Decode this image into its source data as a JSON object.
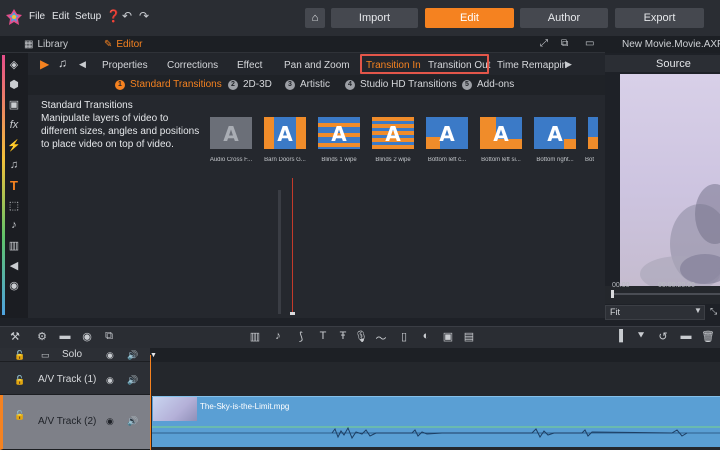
{
  "menu": {
    "file": "File",
    "edit": "Edit",
    "setup": "Setup"
  },
  "modes": {
    "import": "Import",
    "edit": "Edit",
    "author": "Author",
    "export": "Export",
    "active": "Edit"
  },
  "library_tabs": {
    "library": "Library",
    "editor": "Editor"
  },
  "project_title": "New Movie.Movie.AXP",
  "effect_tabs": [
    "Properties",
    "Corrections",
    "Effect",
    "Pan and Zoom",
    "Transition In",
    "Transition Out",
    "Time Remappin"
  ],
  "categories": [
    {
      "num": "1",
      "label": "Standard Transitions"
    },
    {
      "num": "2",
      "label": "2D-3D"
    },
    {
      "num": "3",
      "label": "Artistic"
    },
    {
      "num": "4",
      "label": "Studio HD Transitions"
    },
    {
      "num": "5",
      "label": "Add-ons"
    }
  ],
  "description": {
    "title": "Standard Transitions",
    "body": "Manipulate layers of video to different sizes, angles and positions to place video on top of video."
  },
  "transitions": [
    "Audio Cross F...",
    "Barn Doors G...",
    "Blinds 1 wipe",
    "Blinds 2 wipe",
    "Bottom left c...",
    "Bottom left si...",
    "Bottom right...",
    "Bot"
  ],
  "source": {
    "label": "Source",
    "tc_start": "00:00",
    "tc_mid": "00:00:20.00",
    "fit": "Fit"
  },
  "tracks": [
    {
      "name": "Solo"
    },
    {
      "name": "A/V Track (1)"
    },
    {
      "name": "A/V Track (2)"
    }
  ],
  "clip": {
    "name": "The-Sky-is-the-Limit.mpg"
  },
  "colors": {
    "accent": "#f58220",
    "highlight_box": "#e3564a",
    "clip": "#5a9fd4",
    "thumb_blue": "#3b7ac7",
    "thumb_orange": "#f08c2a"
  }
}
